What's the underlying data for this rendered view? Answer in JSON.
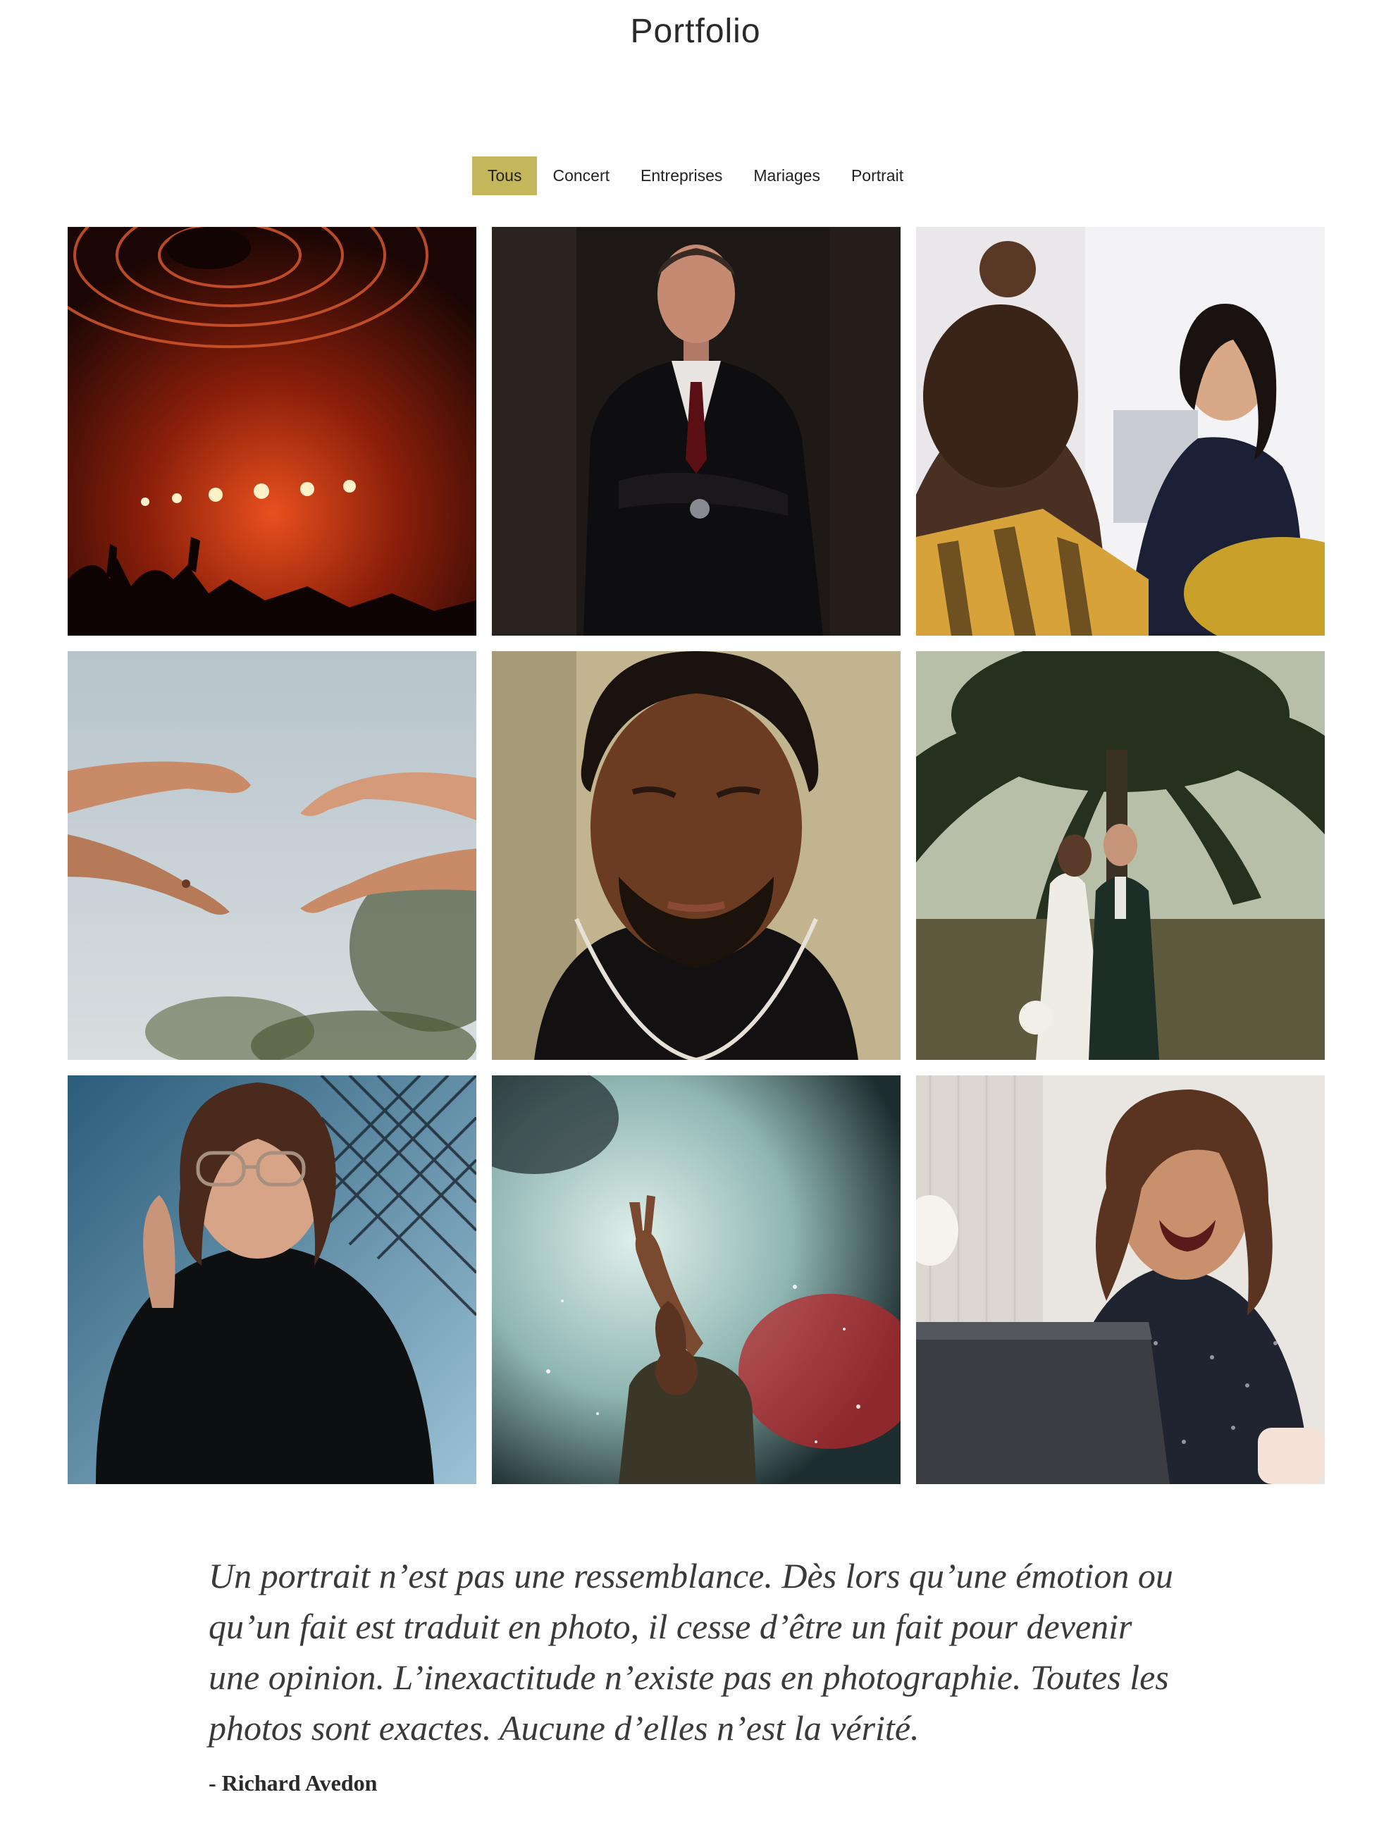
{
  "page": {
    "title": "Portfolio"
  },
  "filters": [
    {
      "label": "Tous",
      "active": true
    },
    {
      "label": "Concert",
      "active": false
    },
    {
      "label": "Entreprises",
      "active": false
    },
    {
      "label": "Mariages",
      "active": false
    },
    {
      "label": "Portrait",
      "active": false
    }
  ],
  "accent_color": "#c4b65a",
  "gallery": [
    {
      "subject": "concert-stage-lights",
      "category": "Concert"
    },
    {
      "subject": "businessman-portrait",
      "category": "Entreprises"
    },
    {
      "subject": "office-meeting-woman",
      "category": "Entreprises"
    },
    {
      "subject": "wedding-hands-ring",
      "category": "Mariages"
    },
    {
      "subject": "man-portrait-closeup",
      "category": "Portrait"
    },
    {
      "subject": "wedding-couple-palm",
      "category": "Mariages"
    },
    {
      "subject": "woman-glasses-portrait",
      "category": "Portrait"
    },
    {
      "subject": "singer-smoke-concert",
      "category": "Concert"
    },
    {
      "subject": "woman-laughing-laptop",
      "category": "Entreprises"
    }
  ],
  "quote": {
    "text": "Un portrait n’est pas une ressemblance. Dès lors qu’une émotion ou qu’un fait est traduit en photo, il cesse d’être un fait pour devenir une opinion. L’inexactitude n’existe pas en photographie. Toutes les photos sont exactes. Aucune d’elles n’est la vérité.",
    "author": "- Richard Avedon"
  }
}
